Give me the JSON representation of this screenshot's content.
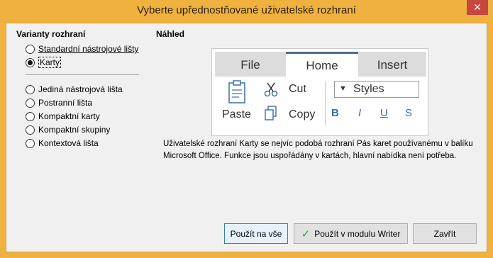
{
  "window": {
    "title": "Vyberte upřednostňované uživatelské rozhraní",
    "close_glyph": "✕"
  },
  "variants": {
    "heading": "Varianty rozhraní",
    "group1": [
      {
        "label": "Standardní nástrojové lišty",
        "checked": false
      },
      {
        "label": "Karty",
        "checked": true
      }
    ],
    "group2": [
      {
        "label": "Jediná nástrojová lišta",
        "checked": false
      },
      {
        "label": "Postranní lišta",
        "checked": false
      },
      {
        "label": "Kompaktní karty",
        "checked": false
      },
      {
        "label": "Kompaktní skupiny",
        "checked": false
      },
      {
        "label": "Kontextová lišta",
        "checked": false
      }
    ]
  },
  "preview": {
    "heading": "Náhled",
    "tabs": [
      {
        "label": "File",
        "active": false
      },
      {
        "label": "Home",
        "active": true
      },
      {
        "label": "Insert",
        "active": false
      }
    ],
    "paste_label": "Paste",
    "cut_label": "Cut",
    "copy_label": "Copy",
    "styles_label": "Styles",
    "styles_arrow": "▼",
    "format_buttons": [
      "B",
      "I",
      "U",
      "S"
    ]
  },
  "description": "Uživatelské rozhraní Karty se nejvíc podobá rozhraní Pás karet používanému v balíku Microsoft Office. Funkce jsou uspořádány v kartách, hlavní nabídka není potřeba.",
  "buttons": {
    "apply_all": "Použít na vše",
    "apply_writer": "Použít v modulu Writer",
    "close": "Zavřít"
  }
}
